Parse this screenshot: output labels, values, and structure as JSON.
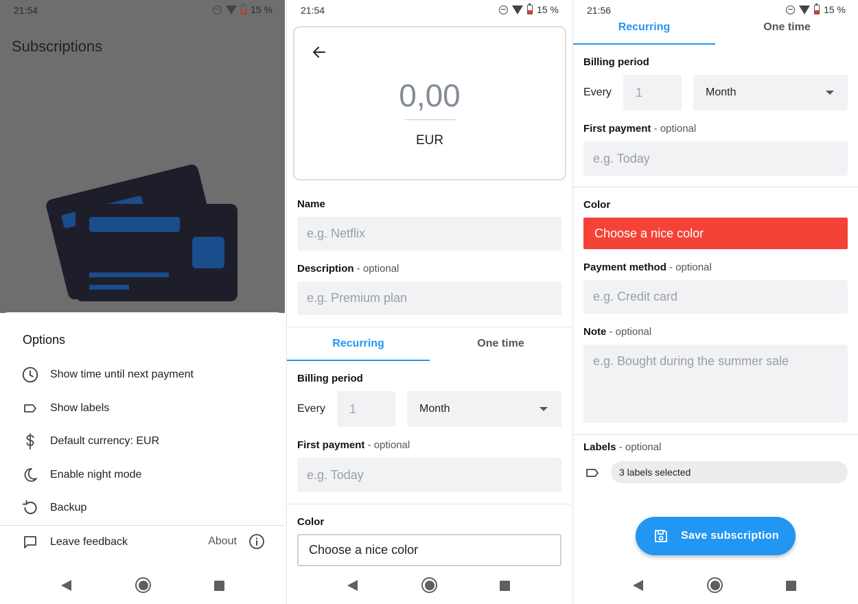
{
  "screens": [
    {
      "status": {
        "time": "21:54",
        "battery": "15 %"
      },
      "title": "Subscriptions",
      "sheet": {
        "title": "Options",
        "items": [
          {
            "icon": "clock-icon",
            "label": "Show time until next payment"
          },
          {
            "icon": "label-icon",
            "label": "Show labels"
          },
          {
            "icon": "dollar-icon",
            "label": "Default currency: EUR"
          },
          {
            "icon": "moon-icon",
            "label": "Enable night mode"
          },
          {
            "icon": "backup-icon",
            "label": "Backup"
          },
          {
            "icon": "feedback-icon",
            "label": "Leave feedback"
          }
        ],
        "about": "About"
      }
    },
    {
      "status": {
        "time": "21:54",
        "battery": "15 %"
      },
      "amount": "0,00",
      "currency": "EUR",
      "name": {
        "label": "Name",
        "placeholder": "e.g. Netflix"
      },
      "description": {
        "label": "Description",
        "optional": " - optional",
        "placeholder": "e.g. Premium plan"
      },
      "tabs": {
        "active": "Recurring",
        "inactive": "One time"
      },
      "billing": {
        "label": "Billing period",
        "every": "Every",
        "count": "1",
        "period": "Month"
      },
      "first_payment": {
        "label": "First payment",
        "optional": " - optional",
        "placeholder": "e.g. Today"
      },
      "color": {
        "label": "Color",
        "value": "Choose a nice color"
      }
    },
    {
      "status": {
        "time": "21:56",
        "battery": "15 %"
      },
      "tabs": {
        "active": "Recurring",
        "inactive": "One time"
      },
      "billing": {
        "label": "Billing period",
        "every": "Every",
        "count": "1",
        "period": "Month"
      },
      "first_payment": {
        "label": "First payment",
        "optional": " - optional",
        "placeholder": "e.g. Today"
      },
      "color": {
        "label": "Color",
        "value": "Choose a nice color",
        "swatch": "#f44336"
      },
      "payment_method": {
        "label": "Payment method",
        "optional": " - optional",
        "placeholder": "e.g. Credit card"
      },
      "note": {
        "label": "Note",
        "optional": " - optional",
        "placeholder": "e.g. Bought during the summer sale"
      },
      "labels": {
        "label": "Labels",
        "optional": " - optional",
        "value": "3 labels selected"
      },
      "save": "Save subscription"
    }
  ],
  "colors": {
    "accent": "#2196f3",
    "danger": "#f44336",
    "card": "#1e1e2b",
    "card_accent": "#1a4d8c"
  }
}
